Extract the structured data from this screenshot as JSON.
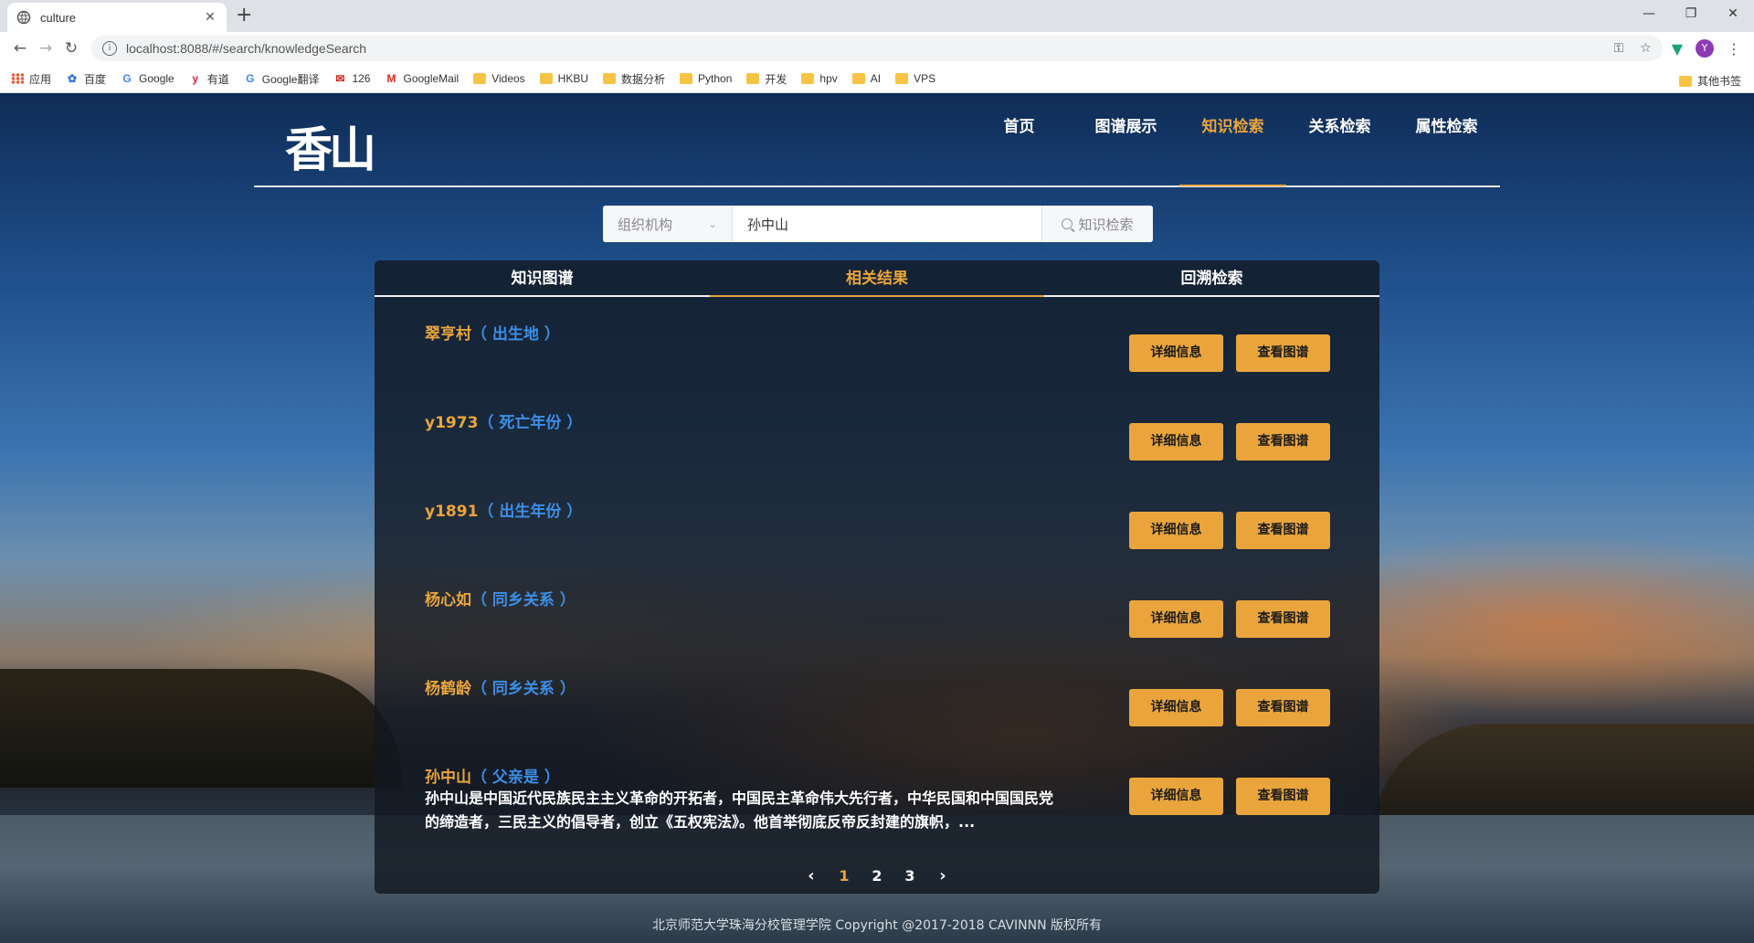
{
  "browser": {
    "tab_title": "culture",
    "url": "localhost:8088/#/search/knowledgeSearch",
    "bookmarks": [
      {
        "label": "应用",
        "icon": "apps-grid-icon"
      },
      {
        "label": "百度",
        "icon": "baidu-icon"
      },
      {
        "label": "Google",
        "icon": "google-icon"
      },
      {
        "label": "有道",
        "icon": "youdao-icon"
      },
      {
        "label": "Google翻译",
        "icon": "google-translate-icon"
      },
      {
        "label": "126",
        "icon": "126-mail-icon"
      },
      {
        "label": "GoogleMail",
        "icon": "gmail-icon"
      },
      {
        "label": "Videos",
        "icon": "folder-icon"
      },
      {
        "label": "HKBU",
        "icon": "folder-icon"
      },
      {
        "label": "数据分析",
        "icon": "folder-icon"
      },
      {
        "label": "Python",
        "icon": "folder-icon"
      },
      {
        "label": "开发",
        "icon": "folder-icon"
      },
      {
        "label": "hpv",
        "icon": "folder-icon"
      },
      {
        "label": "AI",
        "icon": "folder-icon"
      },
      {
        "label": "VPS",
        "icon": "folder-icon"
      }
    ],
    "other_bookmarks": "其他书签",
    "avatar_letter": "Y"
  },
  "site": {
    "logo_text": "香山",
    "nav": [
      {
        "label": "首页",
        "active": false
      },
      {
        "label": "图谱展示",
        "active": false
      },
      {
        "label": "知识检索",
        "active": true
      },
      {
        "label": "关系检索",
        "active": false
      },
      {
        "label": "属性检索",
        "active": false
      }
    ]
  },
  "search": {
    "category": "组织机构",
    "query": "孙中山",
    "button_label": "知识检索"
  },
  "panel": {
    "tabs": [
      "知识图谱",
      "相关结果",
      "回溯检索"
    ],
    "active_tab": "相关结果",
    "detail_label": "详细信息",
    "graph_label": "查看图谱",
    "results": [
      {
        "name": "翠亨村",
        "relation": "（ 出生地 ）",
        "desc": ""
      },
      {
        "name": "y1973",
        "relation": "（ 死亡年份 ）",
        "desc": ""
      },
      {
        "name": "y1891",
        "relation": "（ 出生年份 ）",
        "desc": ""
      },
      {
        "name": "杨心如",
        "relation": "（ 同乡关系 ）",
        "desc": ""
      },
      {
        "name": "杨鹤龄",
        "relation": "（ 同乡关系 ）",
        "desc": ""
      },
      {
        "name": "孙中山",
        "relation": "（ 父亲是 ）",
        "desc": "孙中山是中国近代民族民主主义革命的开拓者，中国民主革命伟大先行者，中华民国和中国国民党的缔造者，三民主义的倡导者，创立《五权宪法》。他首举彻底反帝反封建的旗帜，..."
      }
    ],
    "pager": {
      "prev": "‹",
      "pages": [
        "1",
        "2",
        "3"
      ],
      "current": "1",
      "next": "›"
    }
  },
  "footer": "北京师范大学珠海分校管理学院 Copyright @2017-2018 CAVINNN 版权所有",
  "colors": {
    "accent": "#e9a53c",
    "relation_blue": "#3c8fe8"
  }
}
